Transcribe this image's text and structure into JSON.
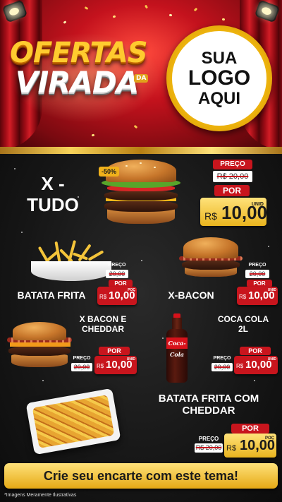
{
  "header": {
    "title_line1": "OFERTAS",
    "title_line2": "VIRADA",
    "title_badge": "DA",
    "logo_line1": "SUA",
    "logo_line2": "LOGO",
    "logo_line3": "AQUI"
  },
  "products": {
    "xtudo": {
      "name_line1": "X -",
      "name_line2": "TUDO",
      "badge": "-50%",
      "price_label": "PREÇO",
      "old_price": "R$ 20,00",
      "por_label": "POR",
      "currency": "R$",
      "new_price": "10,00",
      "unit": "UNID"
    },
    "batata": {
      "name": "BATATA FRITA",
      "price_label": "PREÇO",
      "old_price": "20,00",
      "por_label": "POR",
      "currency": "R$",
      "new_price": "10,00",
      "unit": "POÇ"
    },
    "xbacon": {
      "name": "X-BACON",
      "price_label": "PREÇO",
      "old_price": "20,00",
      "por_label": "POR",
      "currency": "R$",
      "new_price": "10,00",
      "unit": "UNID"
    },
    "xbacon_cheddar": {
      "name_line1": "X BACON E",
      "name_line2": "CHEDDAR",
      "price_label": "PREÇO",
      "old_price": "20,00",
      "por_label": "POR",
      "currency": "R$",
      "new_price": "10,00",
      "unit": "UNID"
    },
    "coca": {
      "name_line1": "COCA COLA",
      "name_line2": "2L",
      "bottle_label": "Coca-Cola",
      "price_label": "PREÇO",
      "old_price": "20,00",
      "por_label": "POR",
      "currency": "R$",
      "new_price": "10,00",
      "unit": "UNID"
    },
    "batata_cheddar": {
      "name_line1": "BATATA FRITA COM",
      "name_line2": "CHEDDAR",
      "price_label": "PREÇO",
      "old_price": "R$ 20,00",
      "por_label": "POR",
      "currency": "R$",
      "new_price": "10,00",
      "unit": "POÇ"
    }
  },
  "cta": "Crie seu encarte com este tema!",
  "disclaimer": "*Imagens Meramente Ilustrativas",
  "colors": {
    "red": "#c8151d",
    "gold": "#f1b80f",
    "background": "#151515"
  }
}
